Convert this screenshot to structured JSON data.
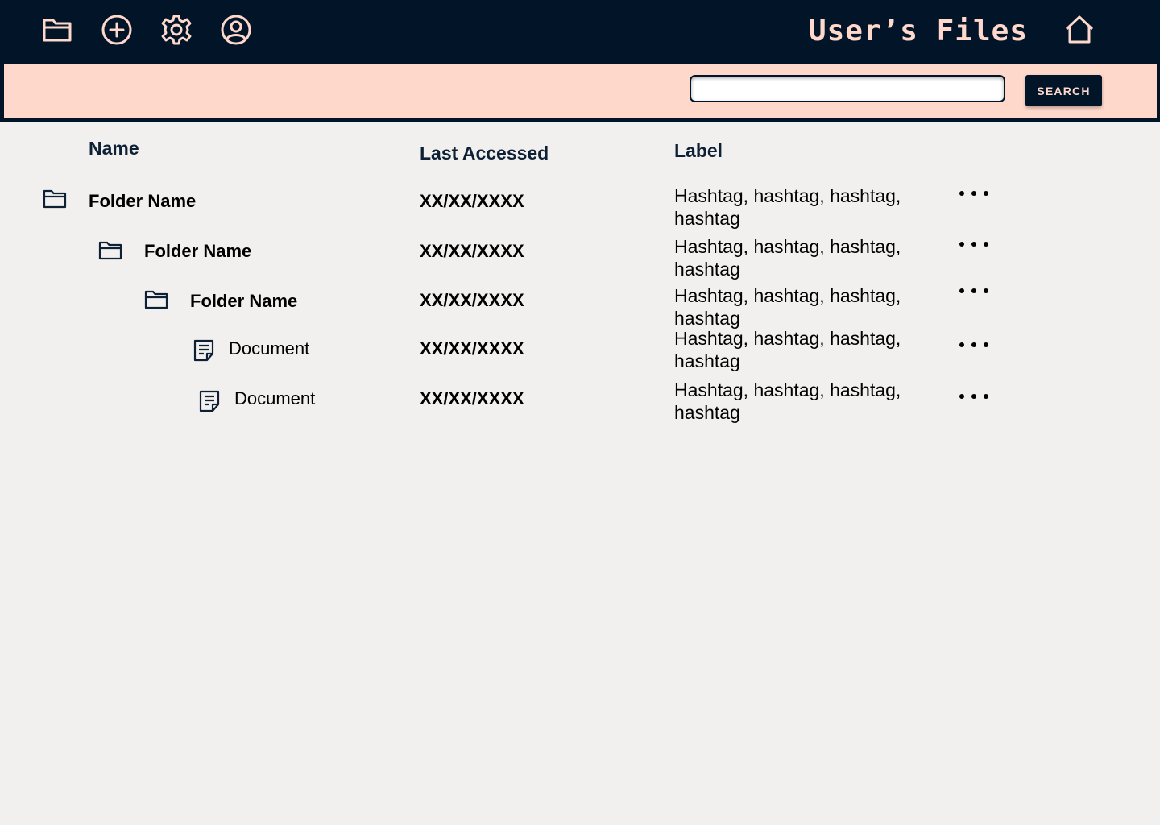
{
  "header": {
    "title": "User’s Files",
    "icons": {
      "folder": "folder-icon",
      "add": "add-circle-icon",
      "settings": "gear-icon",
      "profile": "user-circle-icon",
      "home": "home-icon"
    }
  },
  "search": {
    "value": "",
    "placeholder": "",
    "button_label": "SEARCH"
  },
  "table": {
    "headers": {
      "name": "Name",
      "last_accessed": "Last Accessed",
      "label": "Label"
    },
    "rows": [
      {
        "type": "folder",
        "name": "Folder Name",
        "last_accessed": "XX/XX/XXXX",
        "label": "Hashtag, hashtag, hashtag, hashtag"
      },
      {
        "type": "folder",
        "name": "Folder Name",
        "last_accessed": "XX/XX/XXXX",
        "label": "Hashtag, hashtag, hashtag, hashtag"
      },
      {
        "type": "folder",
        "name": "Folder Name",
        "last_accessed": "XX/XX/XXXX",
        "label": "Hashtag, hashtag, hashtag, hashtag"
      },
      {
        "type": "document",
        "name": "Document",
        "last_accessed": "XX/XX/XXXX",
        "label": "Hashtag, hashtag, hashtag, hashtag"
      },
      {
        "type": "document",
        "name": "Document",
        "last_accessed": "XX/XX/XXXX",
        "label": "Hashtag, hashtag, hashtag, hashtag"
      }
    ]
  },
  "colors": {
    "navy": "#011428",
    "peach": "#ffd8cc",
    "background": "#f2f0ee"
  }
}
